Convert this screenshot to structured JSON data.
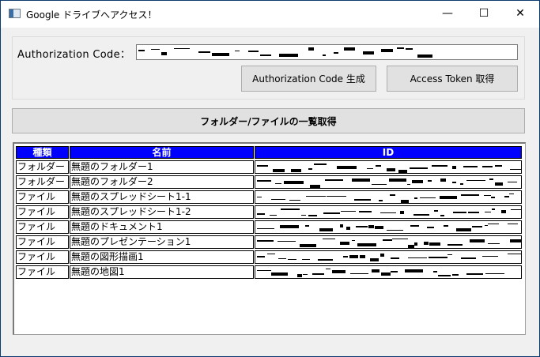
{
  "window": {
    "title": "Google ドライブへアクセス！",
    "minimize": "—",
    "maximize": "☐",
    "close": "✕"
  },
  "auth": {
    "label": "Authorization Code：",
    "code_value_redacted": true,
    "generate_button": "Authorization Code 生成",
    "token_button": "Access Token 取得"
  },
  "list_button": "フォルダー/ファイルの一覧取得",
  "table": {
    "headers": [
      "種類",
      "名前",
      "ID"
    ],
    "header_color": "#0000ff",
    "rows": [
      {
        "type": "フォルダー",
        "name": "無題のフォルダー1"
      },
      {
        "type": "フォルダー",
        "name": "無題のフォルダー2"
      },
      {
        "type": "ファイル",
        "name": "無題のスプレッドシート1-1"
      },
      {
        "type": "ファイル",
        "name": "無題のスプレッドシート1-2"
      },
      {
        "type": "ファイル",
        "name": "無題のドキュメント1"
      },
      {
        "type": "ファイル",
        "name": "無題のプレゼンテーション1"
      },
      {
        "type": "ファイル",
        "name": "無題の図形描画1"
      },
      {
        "type": "ファイル",
        "name": "無題の地図1"
      }
    ]
  }
}
